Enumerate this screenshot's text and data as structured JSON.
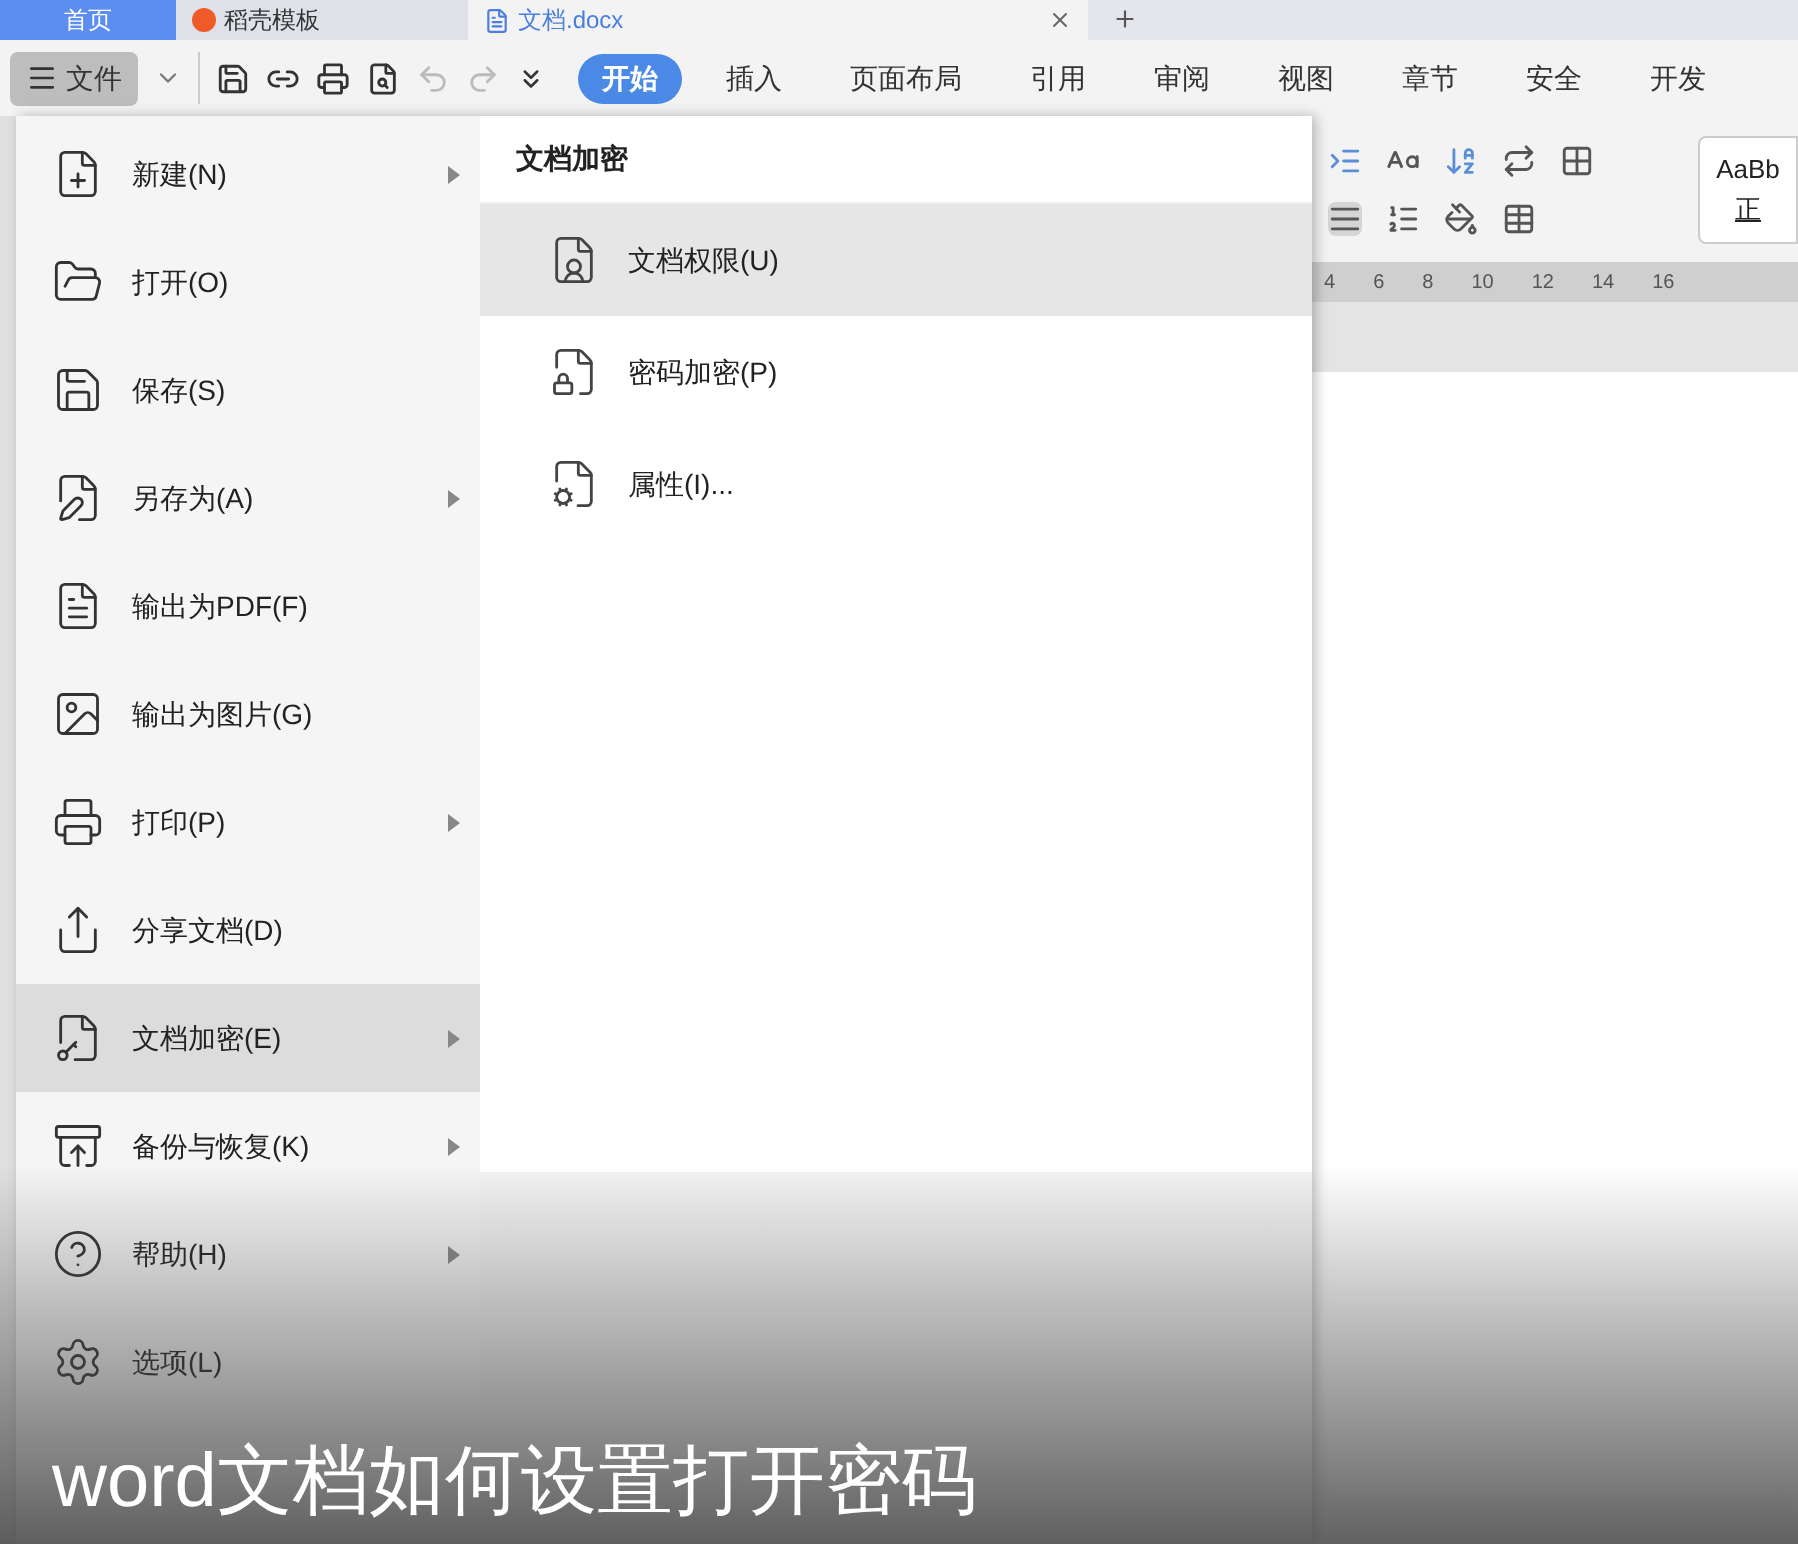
{
  "doc_tabs": [
    {
      "label": "首页",
      "kind": "home",
      "selected": false
    },
    {
      "label": "稻壳模板",
      "kind": "template",
      "selected": false
    },
    {
      "label": "文档.docx",
      "kind": "doc",
      "selected": true
    }
  ],
  "file_button": "文件",
  "ribbon_tabs": [
    {
      "label": "开始",
      "selected": true
    },
    {
      "label": "插入",
      "selected": false
    },
    {
      "label": "页面布局",
      "selected": false
    },
    {
      "label": "引用",
      "selected": false
    },
    {
      "label": "审阅",
      "selected": false
    },
    {
      "label": "视图",
      "selected": false
    },
    {
      "label": "章节",
      "selected": false
    },
    {
      "label": "安全",
      "selected": false
    },
    {
      "label": "开发",
      "selected": false
    }
  ],
  "style_preview": {
    "sample": "AaBb",
    "name": "正"
  },
  "ruler": [
    "4",
    "6",
    "8",
    "10",
    "12",
    "14",
    "16"
  ],
  "menu": {
    "items": [
      {
        "label": "新建(N)",
        "submenu": true,
        "selected": false
      },
      {
        "label": "打开(O)",
        "submenu": false,
        "selected": false
      },
      {
        "label": "保存(S)",
        "submenu": false,
        "selected": false
      },
      {
        "label": "另存为(A)",
        "submenu": true,
        "selected": false
      },
      {
        "label": "输出为PDF(F)",
        "submenu": false,
        "selected": false
      },
      {
        "label": "输出为图片(G)",
        "submenu": false,
        "selected": false
      },
      {
        "label": "打印(P)",
        "submenu": true,
        "selected": false
      },
      {
        "label": "分享文档(D)",
        "submenu": false,
        "selected": false
      },
      {
        "label": "文档加密(E)",
        "submenu": true,
        "selected": true
      },
      {
        "label": "备份与恢复(K)",
        "submenu": true,
        "selected": false
      },
      {
        "label": "帮助(H)",
        "submenu": true,
        "selected": false
      },
      {
        "label": "选项(L)",
        "submenu": false,
        "selected": false
      }
    ]
  },
  "submenu": {
    "title": "文档加密",
    "items": [
      {
        "label": "文档权限(U)",
        "selected": true
      },
      {
        "label": "密码加密(P)",
        "selected": false
      },
      {
        "label": "属性(I)...",
        "selected": false
      }
    ]
  },
  "caption": "word文档如何设置打开密码"
}
